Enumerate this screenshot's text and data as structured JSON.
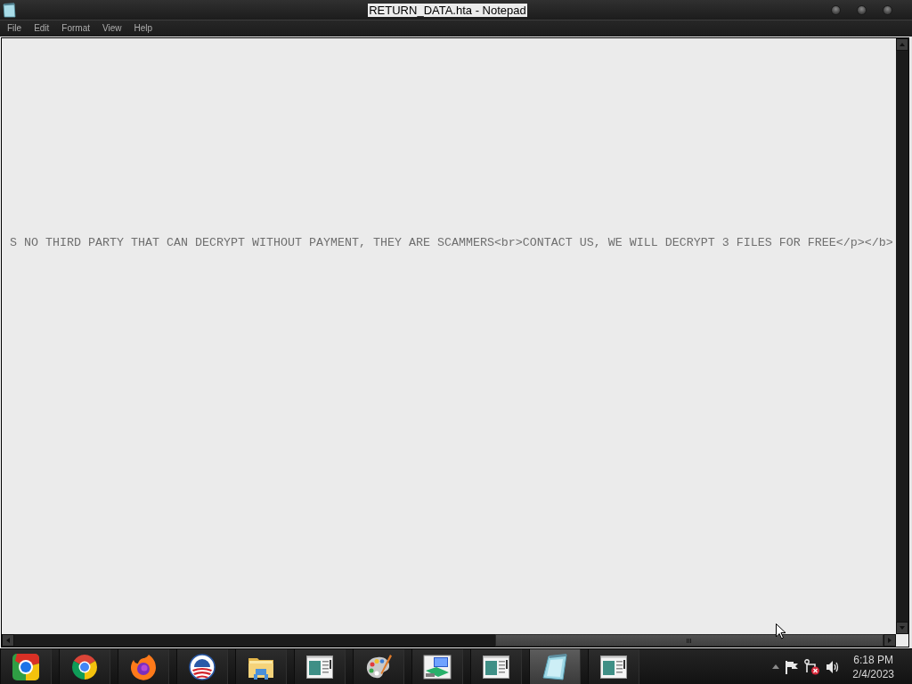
{
  "window": {
    "title": "RETURN_DATA.hta - Notepad"
  },
  "menu": [
    "File",
    "Edit",
    "Format",
    "View",
    "Help"
  ],
  "document": {
    "lines": [
      "S NO THIRD PARTY THAT CAN DECRYPT WITHOUT PAYMENT, THEY ARE SCAMMERS<br>CONTACT US, WE WILL DECRYPT 3 FILES FOR FREE</p></b>"
    ]
  },
  "taskbar": {
    "apps": [
      {
        "kind": "chromium",
        "active": false
      },
      {
        "kind": "chrome",
        "active": false
      },
      {
        "kind": "firefox",
        "active": false
      },
      {
        "kind": "emblem",
        "active": false
      },
      {
        "kind": "folder",
        "active": false
      },
      {
        "kind": "window",
        "active": false
      },
      {
        "kind": "palette",
        "active": false
      },
      {
        "kind": "computer",
        "active": false
      },
      {
        "kind": "window",
        "active": false
      },
      {
        "kind": "notepad",
        "active": true
      },
      {
        "kind": "window",
        "active": false
      }
    ],
    "clock": {
      "time": "6:18 PM",
      "date": "2/4/2023"
    }
  }
}
